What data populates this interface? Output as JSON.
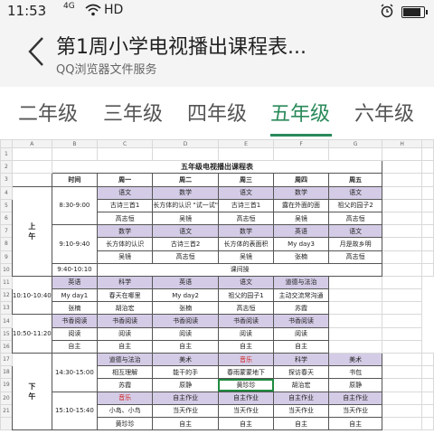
{
  "status_bar": {
    "time": "11:53",
    "signal": "4G",
    "network": "HD",
    "battery_level": 0.85
  },
  "header": {
    "title": "第1周小学电视播出课程表...",
    "subtitle": "QQ浏览器文件服务"
  },
  "tabs": [
    {
      "label": "二年级",
      "active": false
    },
    {
      "label": "三年级",
      "active": false
    },
    {
      "label": "四年级",
      "active": false
    },
    {
      "label": "五年级",
      "active": true
    },
    {
      "label": "六年级",
      "active": false
    }
  ],
  "sheet": {
    "columns": [
      "A",
      "B",
      "C",
      "D",
      "E",
      "F",
      "G",
      "H"
    ],
    "rows": [
      "1",
      "2",
      "3",
      "4",
      "5",
      "6",
      "7",
      "8",
      "9",
      "10",
      "11",
      "12",
      "13",
      "14",
      "15",
      "16",
      "17",
      "18",
      "19",
      "20",
      "21"
    ],
    "title": "五年级电视播出课程表",
    "col_headers": [
      "时间",
      "周一",
      "周二",
      "周三",
      "周四",
      "周五"
    ],
    "side_labels": {
      "morning": "上\n午",
      "afternoon": "下\n午"
    },
    "times": [
      "8:30-9:00",
      "9:10-9:40",
      "9:40-10:10",
      "10:10-10:40",
      "10:50-11:20",
      "14:30-15:00",
      "15:10-15:40"
    ],
    "break_label": "课间操",
    "rows_data": [
      [
        "语文",
        "数学",
        "语文",
        "数学",
        "语文"
      ],
      [
        "古诗三首1",
        "长方体的认识  \"试一试\"",
        "古诗三首1",
        "露在外面的面",
        "祖父的园子2"
      ],
      [
        "高志恒",
        "吴镜",
        "高志恒",
        "吴镜",
        "高志恒"
      ],
      [
        "数学",
        "语文",
        "数学",
        "英语",
        "语文"
      ],
      [
        "长方体的认识",
        "古诗三首2",
        "长方体的表面积",
        "My day3",
        "月是故乡明"
      ],
      [
        "吴镜",
        "高志恒",
        "吴镜",
        "张楠",
        "高志恒"
      ],
      [
        "英语",
        "科学",
        "英语",
        "语文",
        "道德与法治"
      ],
      [
        "My day1",
        "春天在哪里",
        "My day2",
        "祖父的园子1",
        "主动交流常沟通"
      ],
      [
        "张楠",
        "胡治宏",
        "张楠",
        "高志恒",
        "苏霞"
      ],
      [
        "书香阅读",
        "书香阅读",
        "书香阅读",
        "书香阅读",
        "书香阅读"
      ],
      [
        "阅读",
        "阅读",
        "阅读",
        "阅读",
        "阅读"
      ],
      [
        "自主",
        "自主",
        "自主",
        "自主",
        "自主"
      ],
      [
        "道德与法治",
        "美术",
        "音乐",
        "科学",
        "美术"
      ],
      [
        "相互理解",
        "能干的手",
        "春雨蒙蒙地下",
        "探访春天",
        "书包"
      ],
      [
        "苏霞",
        "原静",
        "黄珍珍",
        "胡治宏",
        "原静"
      ],
      [
        "音乐",
        "自主作业",
        "自主作业",
        "自主作业",
        "自主作业"
      ],
      [
        "小岛、小鸟",
        "当天作业",
        "当天作业",
        "当天作业",
        "当天作业"
      ],
      [
        "黄珍珍",
        "自主",
        "自主",
        "自主",
        "自主"
      ]
    ]
  },
  "colors": {
    "accent": "#2a8a5a",
    "purple_cell": "#d4cce6",
    "red_text": "#d02020",
    "selection": "#1e8a3e"
  }
}
